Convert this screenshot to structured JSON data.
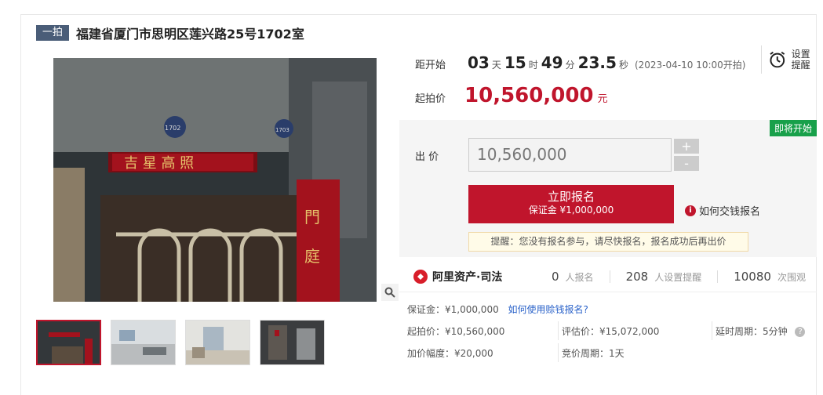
{
  "header": {
    "tag": "一拍",
    "title": "福建省厦门市思明区莲兴路25号1702室"
  },
  "countdown": {
    "label": "距开始",
    "days": "03",
    "days_unit": "天",
    "hours": "15",
    "hours_unit": "时",
    "minutes": "49",
    "minutes_unit": "分",
    "seconds": "23.5",
    "seconds_unit": "秒",
    "start_note": "(2023-04-10 10:00开拍)"
  },
  "reminder": {
    "label": "设置提醒"
  },
  "start_price": {
    "label": "起拍价",
    "value": "10,560,000",
    "unit": "元"
  },
  "bid": {
    "status_badge": "即将开始",
    "label": "出 价",
    "input_value": "10,560,000",
    "plus": "+",
    "minus": "-",
    "signup_title": "立即报名",
    "signup_sub": "保证金 ¥1,000,000",
    "how_to_pay": "如何交钱报名",
    "tip": "提醒：您没有报名参与，请尽快报名，报名成功后再出价"
  },
  "brand": {
    "name": "阿里资产·司法"
  },
  "stats": [
    {
      "value": "0",
      "unit": "人报名"
    },
    {
      "value": "208",
      "unit": "人设置提醒"
    },
    {
      "value": "10080",
      "unit": "次围观"
    }
  ],
  "details": {
    "deposit": "保证金：¥1,000,000",
    "deposit_link": "如何使用赊钱报名?",
    "start_price": "起拍价：¥10,560,000",
    "appraisal": "评估价：¥15,072,000",
    "delay": "延时周期：5分钟",
    "increment": "加价幅度：¥20,000",
    "cycle": "竞价周期：1天"
  },
  "colors": {
    "accent": "#c0152c",
    "badge_green": "#18a04a",
    "link": "#2a62c9"
  }
}
